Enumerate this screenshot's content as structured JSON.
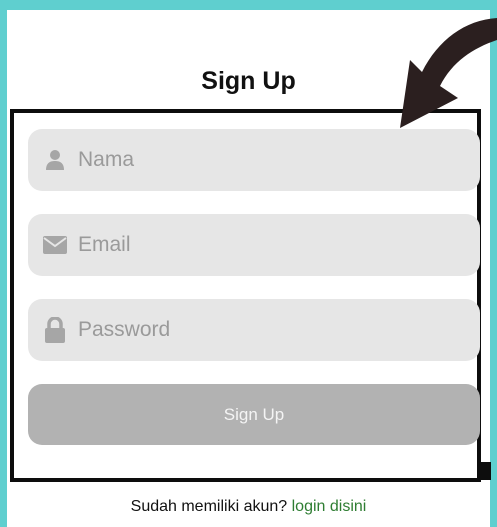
{
  "page": {
    "title": "Sign Up"
  },
  "form": {
    "name_placeholder": "Nama",
    "email_placeholder": "Email",
    "password_placeholder": "Password",
    "submit_label": "Sign Up"
  },
  "footer": {
    "prompt": "Sudah memiliki akun?",
    "login_link": "login disini"
  },
  "icons": {
    "name": "user-icon",
    "email": "envelope-icon",
    "password": "lock-icon"
  },
  "colors": {
    "background": "#5fcfcf",
    "field_bg": "#e6e6e6",
    "button_bg": "#b2b2b2",
    "link": "#2e7d32",
    "annotation": "#2b1f1f"
  }
}
